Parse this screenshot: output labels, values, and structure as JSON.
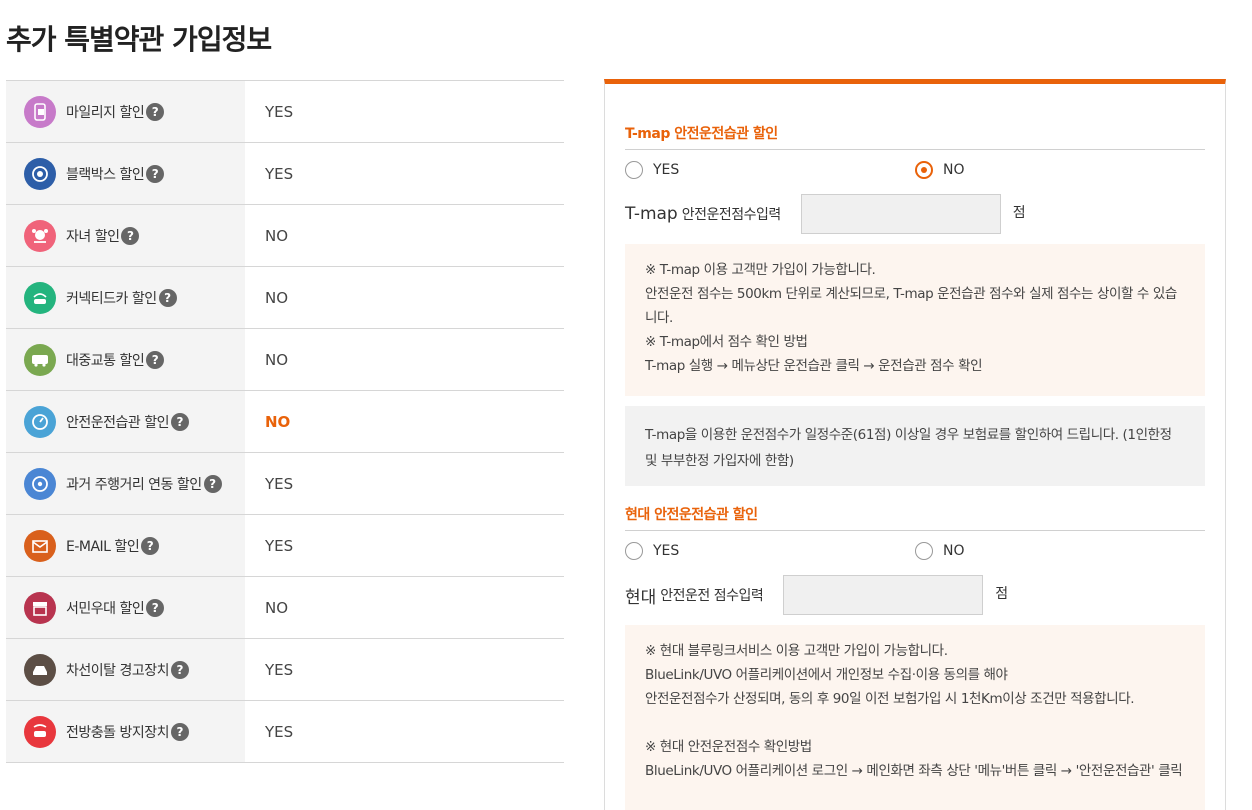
{
  "page": {
    "title": "추가 특별약관 가입정보"
  },
  "discounts": [
    {
      "label": "마일리지 할인",
      "value": "YES",
      "icon": "phone-mileage-icon",
      "color": "#c77ac9",
      "highlight": false
    },
    {
      "label": "블랙박스 할인",
      "value": "YES",
      "icon": "camera-icon",
      "color": "#2d5ea8",
      "highlight": false
    },
    {
      "label": "자녀 할인",
      "value": "NO",
      "icon": "child-icon",
      "color": "#f0637a",
      "highlight": false
    },
    {
      "label": "커넥티드카 할인",
      "value": "NO",
      "icon": "connected-car-icon",
      "color": "#24b47e",
      "highlight": false
    },
    {
      "label": "대중교통 할인",
      "value": "NO",
      "icon": "bus-icon",
      "color": "#7aa850",
      "highlight": false
    },
    {
      "label": "안전운전습관 할인",
      "value": "NO",
      "icon": "speedometer-icon",
      "color": "#4aa3d6",
      "highlight": true
    },
    {
      "label": "과거 주행거리 연동 할인",
      "value": "YES",
      "icon": "odometer-icon",
      "color": "#4a86d4",
      "highlight": false
    },
    {
      "label": "E-MAIL 할인",
      "value": "YES",
      "icon": "email-icon",
      "color": "#d9601c",
      "highlight": false
    },
    {
      "label": "서민우대 할인",
      "value": "NO",
      "icon": "store-icon",
      "color": "#b8344f",
      "highlight": false
    },
    {
      "label": "차선이탈 경고장치",
      "value": "YES",
      "icon": "lane-car-icon",
      "color": "#5c4e45",
      "highlight": false
    },
    {
      "label": "전방충돌 방지장치",
      "value": "YES",
      "icon": "collision-car-icon",
      "color": "#e8373d",
      "highlight": false
    }
  ],
  "help_glyph": "?",
  "tmap": {
    "title": "T-map 안전운전습관 할인",
    "yes_label": "YES",
    "no_label": "NO",
    "selected": "NO",
    "score_main": "T-map",
    "score_sub": "안전운전점수입력",
    "score_value": "",
    "unit": "점",
    "notes": [
      "※ T-map 이용 고객만 가입이 가능합니다.",
      "안전운전 점수는 500km 단위로 계산되므로, T-map 운전습관 점수와 실제 점수는 상이할 수 있습니다.",
      "※ T-map에서 점수 확인 방법",
      "T-map 실행 → 메뉴상단 운전습관 클릭 → 운전습관 점수 확인"
    ],
    "info": "T-map을 이용한 운전점수가 일정수준(61점) 이상일 경우 보험료를 할인하여 드립니다. (1인한정 및 부부한정 가입자에 한함)"
  },
  "hyundai": {
    "title": "현대 안전운전습관 할인",
    "yes_label": "YES",
    "no_label": "NO",
    "selected": "",
    "score_main": "현대",
    "score_sub": "안전운전 점수입력",
    "score_value": "",
    "unit": "점",
    "notes": [
      "※ 현대 블루링크서비스 이용 고객만 가입이 가능합니다.",
      "BlueLink/UVO 어플리케이션에서 개인정보 수집·이용 동의를 해야",
      "안전운전점수가 산정되며, 동의 후 90일 이전 보험가입 시 1천Km이상 조건만 적용합니다.",
      "",
      "※ 현대 안전운전점수 확인방법",
      "BlueLink/UVO 어플리케이션 로그인 → 메인화면 좌측 상단 '메뉴'버튼 클릭 → '안전운전습관' 클릭"
    ]
  },
  "colors": {
    "accent": "#e9620a",
    "note_bg": "#fdf5ef",
    "info_bg": "#f2f2f2",
    "label_bg": "#f4f4f4"
  }
}
